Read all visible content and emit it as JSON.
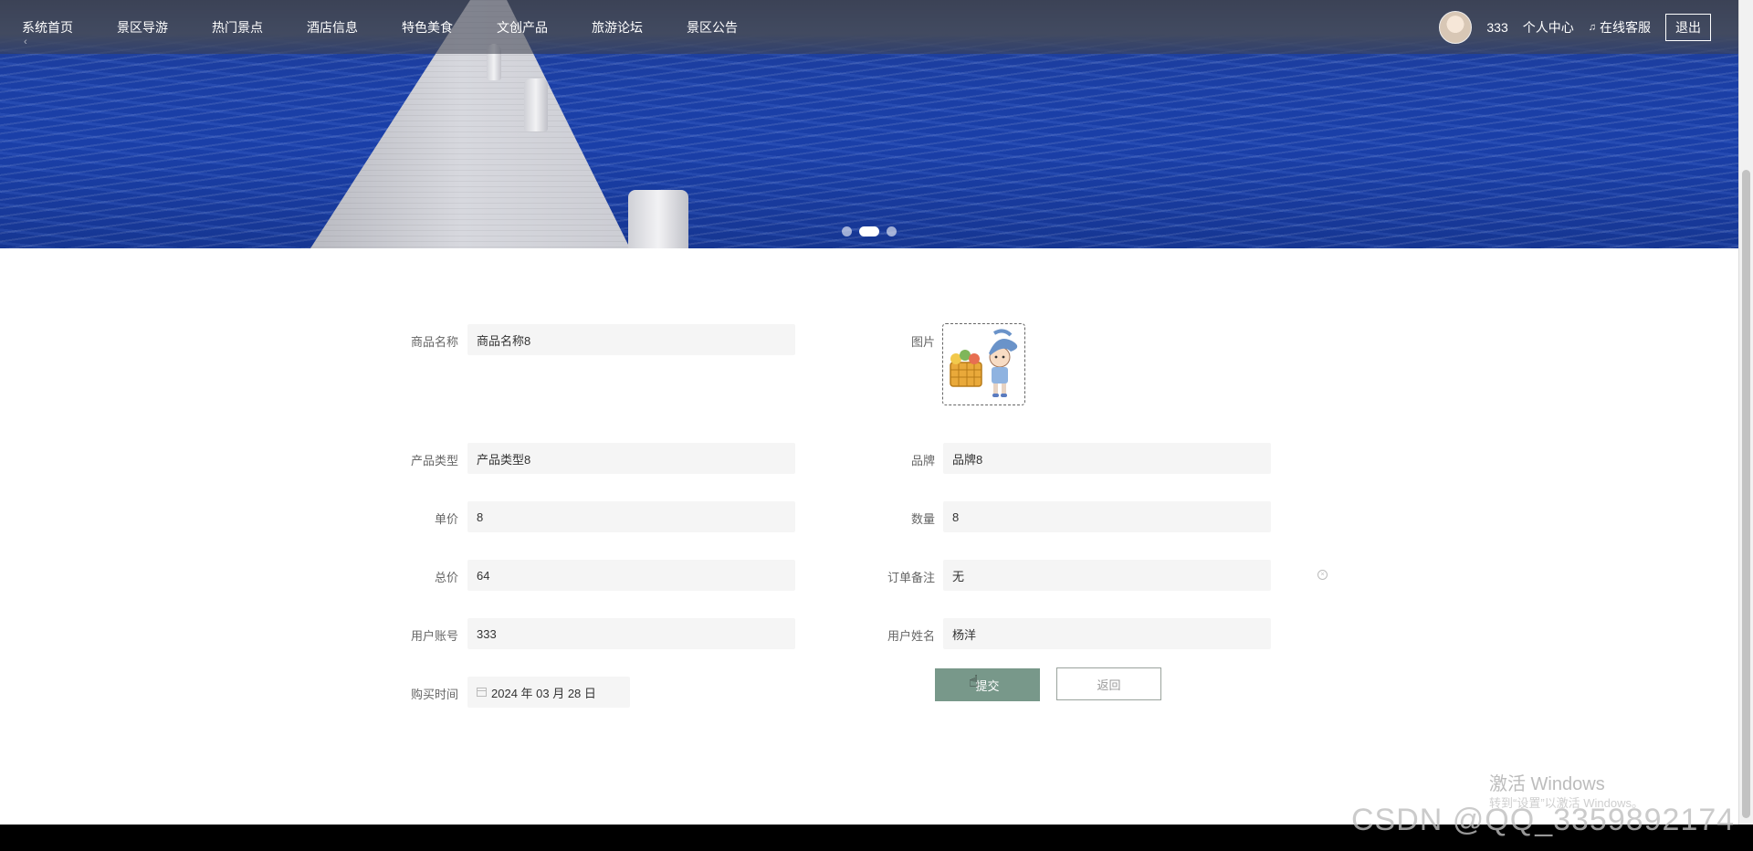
{
  "nav": {
    "items": [
      "系统首页",
      "景区导游",
      "热门景点",
      "酒店信息",
      "特色美食",
      "文创产品",
      "旅游论坛",
      "景区公告"
    ],
    "username": "333",
    "personal_center": "个人中心",
    "service": "在线客服",
    "logout": "退出",
    "back": "‹"
  },
  "banner": {
    "slides": 3,
    "active_slide": 2
  },
  "form": {
    "product_name": {
      "label": "商品名称",
      "value": "商品名称8"
    },
    "image": {
      "label": "图片"
    },
    "product_type": {
      "label": "产品类型",
      "value": "产品类型8"
    },
    "brand": {
      "label": "品牌",
      "value": "品牌8"
    },
    "unit_price": {
      "label": "单价",
      "value": "8"
    },
    "quantity": {
      "label": "数量",
      "value": "8"
    },
    "total_price": {
      "label": "总价",
      "value": "64"
    },
    "order_note": {
      "label": "订单备注",
      "value": "无"
    },
    "user_account": {
      "label": "用户账号",
      "value": "333"
    },
    "user_name": {
      "label": "用户姓名",
      "value": "杨洋"
    },
    "purchase_time": {
      "label": "购买时间",
      "value": "2024 年 03 月 28 日"
    },
    "submit": "提交",
    "back": "返回"
  },
  "watermarks": {
    "windows_title": "激活 Windows",
    "windows_sub": "转到“设置”以激活 Windows。",
    "csdn": "CSDN @QQ_3359892174"
  },
  "colors": {
    "submit": "#78988a",
    "nav_bg": "#3c404e"
  }
}
